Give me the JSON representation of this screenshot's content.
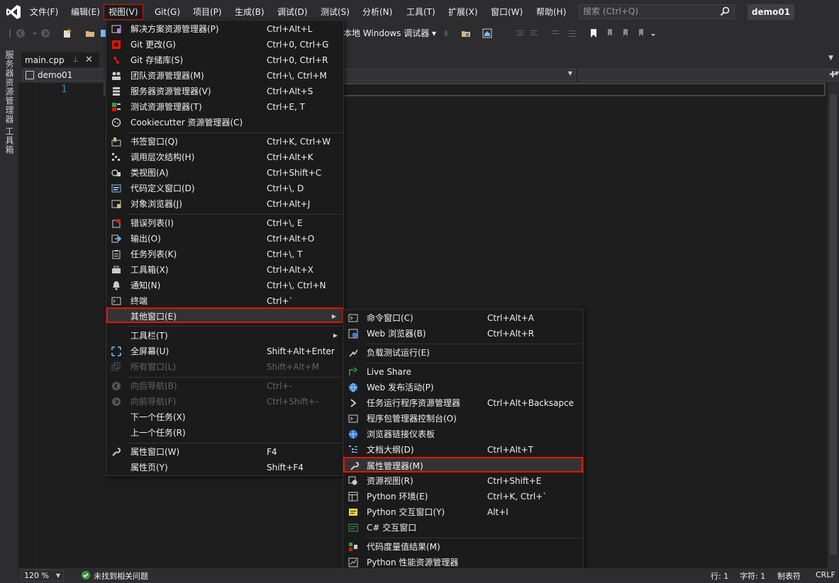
{
  "menubar": {
    "items": [
      "文件(F)",
      "编辑(E)",
      "视图(V)",
      "Git(G)",
      "项目(P)",
      "生成(B)",
      "调试(D)",
      "测试(S)",
      "分析(N)",
      "工具(T)",
      "扩展(X)",
      "窗口(W)",
      "帮助(H)"
    ],
    "active": "视图(V)",
    "search_placeholder": "搜索 (Ctrl+Q)",
    "project_name": "demo01"
  },
  "toolbar": {
    "debugger_label": "本地 Windows 调试器 ▾"
  },
  "leftbar": {
    "tab1": "服务器资源管理器",
    "tab2": "工具箱"
  },
  "doctab": {
    "label": "main.cpp",
    "pin": "⊥",
    "close": "✕"
  },
  "navbar": {
    "project": "demo01"
  },
  "editor": {
    "line_number": "1"
  },
  "view_menu": {
    "items": [
      {
        "icon": "solution-explorer-icon",
        "label": "解决方案资源管理器(P)",
        "shortcut": "Ctrl+Alt+L"
      },
      {
        "icon": "git-changes-icon",
        "label": "Git 更改(G)",
        "shortcut": "Ctrl+0, Ctrl+G"
      },
      {
        "icon": "git-repo-icon",
        "label": "Git 存储库(S)",
        "shortcut": "Ctrl+0, Ctrl+R"
      },
      {
        "icon": "team-explorer-icon",
        "label": "团队资源管理器(M)",
        "shortcut": "Ctrl+\\, Ctrl+M"
      },
      {
        "icon": "server-explorer-icon",
        "label": "服务器资源管理器(V)",
        "shortcut": "Ctrl+Alt+S"
      },
      {
        "icon": "test-explorer-icon",
        "label": "测试资源管理器(T)",
        "shortcut": "Ctrl+E, T"
      },
      {
        "icon": "cookiecutter-icon",
        "label": "Cookiecutter 资源管理器(C)",
        "shortcut": ""
      },
      {
        "icon": "bookmark-window-icon",
        "label": "书签窗口(Q)",
        "shortcut": "Ctrl+K, Ctrl+W"
      },
      {
        "icon": "call-hierarchy-icon",
        "label": "调用层次结构(H)",
        "shortcut": "Ctrl+Alt+K"
      },
      {
        "icon": "class-view-icon",
        "label": "类视图(A)",
        "shortcut": "Ctrl+Shift+C"
      },
      {
        "icon": "code-definition-icon",
        "label": "代码定义窗口(D)",
        "shortcut": "Ctrl+\\, D"
      },
      {
        "icon": "object-browser-icon",
        "label": "对象浏览器(J)",
        "shortcut": "Ctrl+Alt+J"
      },
      {
        "icon": "error-list-icon",
        "label": "错误列表(I)",
        "shortcut": "Ctrl+\\, E"
      },
      {
        "icon": "output-icon",
        "label": "输出(O)",
        "shortcut": "Ctrl+Alt+O"
      },
      {
        "icon": "task-list-icon",
        "label": "任务列表(K)",
        "shortcut": "Ctrl+\\, T"
      },
      {
        "icon": "toolbox-icon",
        "label": "工具箱(X)",
        "shortcut": "Ctrl+Alt+X"
      },
      {
        "icon": "bell-icon",
        "label": "通知(N)",
        "shortcut": "Ctrl+\\, Ctrl+N"
      },
      {
        "icon": "terminal-icon",
        "label": "终端",
        "shortcut": "Ctrl+`"
      },
      {
        "icon": "",
        "label": "其他窗口(E)",
        "shortcut": ""
      },
      {
        "icon": "",
        "label": "工具栏(T)",
        "shortcut": ""
      },
      {
        "icon": "fullscreen-icon",
        "label": "全屏幕(U)",
        "shortcut": "Shift+Alt+Enter"
      },
      {
        "icon": "all-windows-icon",
        "label": "所有窗口(L)",
        "shortcut": "Shift+Alt+M"
      },
      {
        "icon": "navigate-back-icon",
        "label": "向后导航(B)",
        "shortcut": "Ctrl+-"
      },
      {
        "icon": "navigate-forward-icon",
        "label": "向前导航(F)",
        "shortcut": "Ctrl+Shift+-"
      },
      {
        "icon": "",
        "label": "下一个任务(X)",
        "shortcut": ""
      },
      {
        "icon": "",
        "label": "上一个任务(R)",
        "shortcut": ""
      },
      {
        "icon": "wrench-icon",
        "label": "属性窗口(W)",
        "shortcut": "F4"
      },
      {
        "icon": "",
        "label": "属性页(Y)",
        "shortcut": "Shift+F4"
      }
    ]
  },
  "other_menu": {
    "items": [
      {
        "icon": "command-window-icon",
        "label": "命令窗口(C)",
        "shortcut": "Ctrl+Alt+A"
      },
      {
        "icon": "web-browser-icon",
        "label": "Web 浏览器(B)",
        "shortcut": "Ctrl+Alt+R"
      },
      {
        "icon": "load-test-icon",
        "label": "负载测试运行(E)",
        "shortcut": ""
      },
      {
        "icon": "live-share-icon",
        "label": "Live Share",
        "shortcut": ""
      },
      {
        "icon": "globe-icon",
        "label": "Web 发布活动(P)",
        "shortcut": ""
      },
      {
        "icon": "chevron-right-icon",
        "label": "任务运行程序资源管理器",
        "shortcut": "Ctrl+Alt+Backsapce"
      },
      {
        "icon": "console-icon",
        "label": "程序包管理器控制台(O)",
        "shortcut": ""
      },
      {
        "icon": "browser-link-icon",
        "label": "浏览器链接仪表板",
        "shortcut": ""
      },
      {
        "icon": "document-outline-icon",
        "label": "文档大纲(D)",
        "shortcut": "Ctrl+Alt+T"
      },
      {
        "icon": "wrench-icon",
        "label": "属性管理器(M)",
        "shortcut": ""
      },
      {
        "icon": "resource-view-icon",
        "label": "资源视图(R)",
        "shortcut": "Ctrl+Shift+E"
      },
      {
        "icon": "python-env-icon",
        "label": "Python 环境(E)",
        "shortcut": "Ctrl+K, Ctrl+`"
      },
      {
        "icon": "python-interactive-icon",
        "label": "Python 交互窗口(Y)",
        "shortcut": "Alt+I"
      },
      {
        "icon": "csharp-interactive-icon",
        "label": "C# 交互窗口",
        "shortcut": ""
      },
      {
        "icon": "code-metrics-icon",
        "label": "代码度量值结果(M)",
        "shortcut": ""
      },
      {
        "icon": "python-profiler-icon",
        "label": "Python 性能资源管理器",
        "shortcut": ""
      }
    ]
  },
  "statusbar": {
    "zoom": "120 %",
    "issues": "未找到相关问题",
    "line": "行: 1",
    "char": "字符: 1",
    "tab_mode": "制表符",
    "line_ending": "CRLF"
  },
  "colors": {
    "accent_red": "#e51400",
    "background": "#1e1e1e",
    "chrome": "#2d2d30"
  }
}
